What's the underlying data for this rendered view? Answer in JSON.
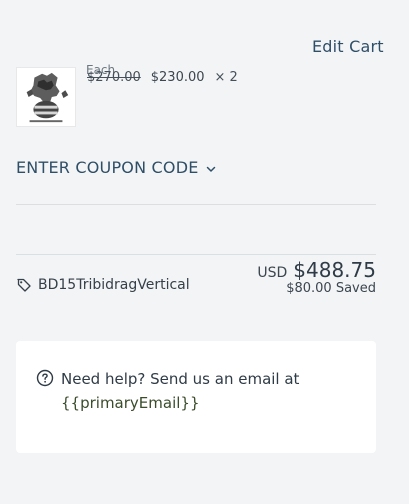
{
  "header": {
    "edit_cart_label": "Edit Cart"
  },
  "item": {
    "each_label": "Each",
    "old_price": "$270.00",
    "new_price": "$230.00",
    "quantity_symbol": "×",
    "quantity": "2"
  },
  "coupon": {
    "label": "ENTER COUPON CODE",
    "icon": "chevron-down-icon"
  },
  "discount": {
    "icon": "tag-icon",
    "code": "BD15TribidragVertical"
  },
  "totals": {
    "currency": "USD",
    "amount": "$488.75",
    "saved": "$80.00 Saved"
  },
  "help": {
    "icon": "question-circle-icon",
    "text": "Need help? Send us an email at",
    "email": "{{primaryEmail}}"
  },
  "colors": {
    "background": "#f3f4f5",
    "link": "#2f4f68",
    "card": "#ffffff",
    "divider": "#dcdfe2",
    "text": "#2f3b46"
  }
}
